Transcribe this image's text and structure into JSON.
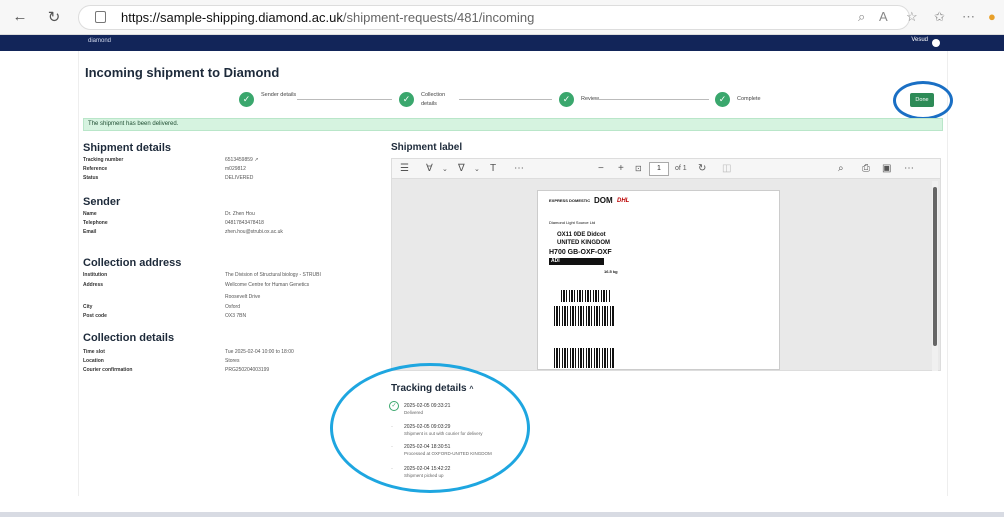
{
  "browser": {
    "url_host": "https://sample-shipping.diamond.ac.uk",
    "url_path": "/shipment-requests/481/incoming",
    "back_icon": "back-arrow-icon",
    "reload_icon": "reload-icon"
  },
  "app": {
    "logo": "diamond",
    "user": "Vesud"
  },
  "page": {
    "title": "Incoming shipment to Diamond",
    "steps": [
      {
        "label": "Sender details"
      },
      {
        "label": "Collection details"
      },
      {
        "label": "Review"
      },
      {
        "label": "Complete"
      }
    ],
    "done_label": "Done",
    "alert": "The shipment has been delivered."
  },
  "shipment_details": {
    "title": "Shipment details",
    "rows": [
      {
        "k": "Tracking number",
        "v": "6513459859"
      },
      {
        "k": "Reference",
        "v": "m029812"
      },
      {
        "k": "Status",
        "v": "DELIVERED"
      }
    ]
  },
  "sender": {
    "title": "Sender",
    "rows": [
      {
        "k": "Name",
        "v": "Dr. Zhen Hou"
      },
      {
        "k": "Telephone",
        "v": "04817843478418"
      },
      {
        "k": "Email",
        "v": "zhen.hou@strubi.ox.ac.uk"
      }
    ]
  },
  "collection_address": {
    "title": "Collection address",
    "rows": [
      {
        "k": "Institution",
        "v": "The Division of Structural biology - STRUBI"
      },
      {
        "k": "Address",
        "v": "Wellcome Centre for Human Genetics"
      },
      {
        "k": "",
        "v": "Roosevelt Drive"
      },
      {
        "k": "City",
        "v": "Oxford"
      },
      {
        "k": "Post code",
        "v": "OX3 7BN"
      }
    ]
  },
  "collection_details": {
    "title": "Collection details",
    "rows": [
      {
        "k": "Time slot",
        "v": "Tue 2025-02-04 10:00 to 18:00"
      },
      {
        "k": "Location",
        "v": "Stores"
      },
      {
        "k": "Courier confirmation",
        "v": "PRG250204003199"
      }
    ]
  },
  "shipment_label": {
    "title": "Shipment label",
    "page_number": "1",
    "page_of": "of 1",
    "label_text": {
      "express": "EXPRESS DOMESTIC",
      "dom": "DOM",
      "carrier": "DHL",
      "recipient": "Diamond Light Source Ltd",
      "postcode": "OX11 0DE Didcot",
      "country": "UNITED KINGDOM",
      "route": "H700 GB-OXF-OXF",
      "route_code": "ADI",
      "weight": "16.5 kg"
    }
  },
  "tracking": {
    "title": "Tracking details",
    "events": [
      {
        "date": "2025-02-05 09:33:21",
        "desc": "Delivered"
      },
      {
        "date": "2025-02-05 09:03:29",
        "desc": "Shipment is out with courier for delivery"
      },
      {
        "date": "2025-02-04 18:30:51",
        "desc": "Processed at OXFORD-UNITED KINGDOM"
      },
      {
        "date": "2025-02-04 15:42:22",
        "desc": "Shipment picked up"
      }
    ]
  },
  "colors": {
    "app_bar": "#122559",
    "success": "#3aa76d",
    "done_button": "#2e8b57",
    "alert_bg": "#d6f3e0",
    "annotation_circle_1": "#1a6fc4",
    "annotation_circle_2": "#1ea6e0"
  }
}
